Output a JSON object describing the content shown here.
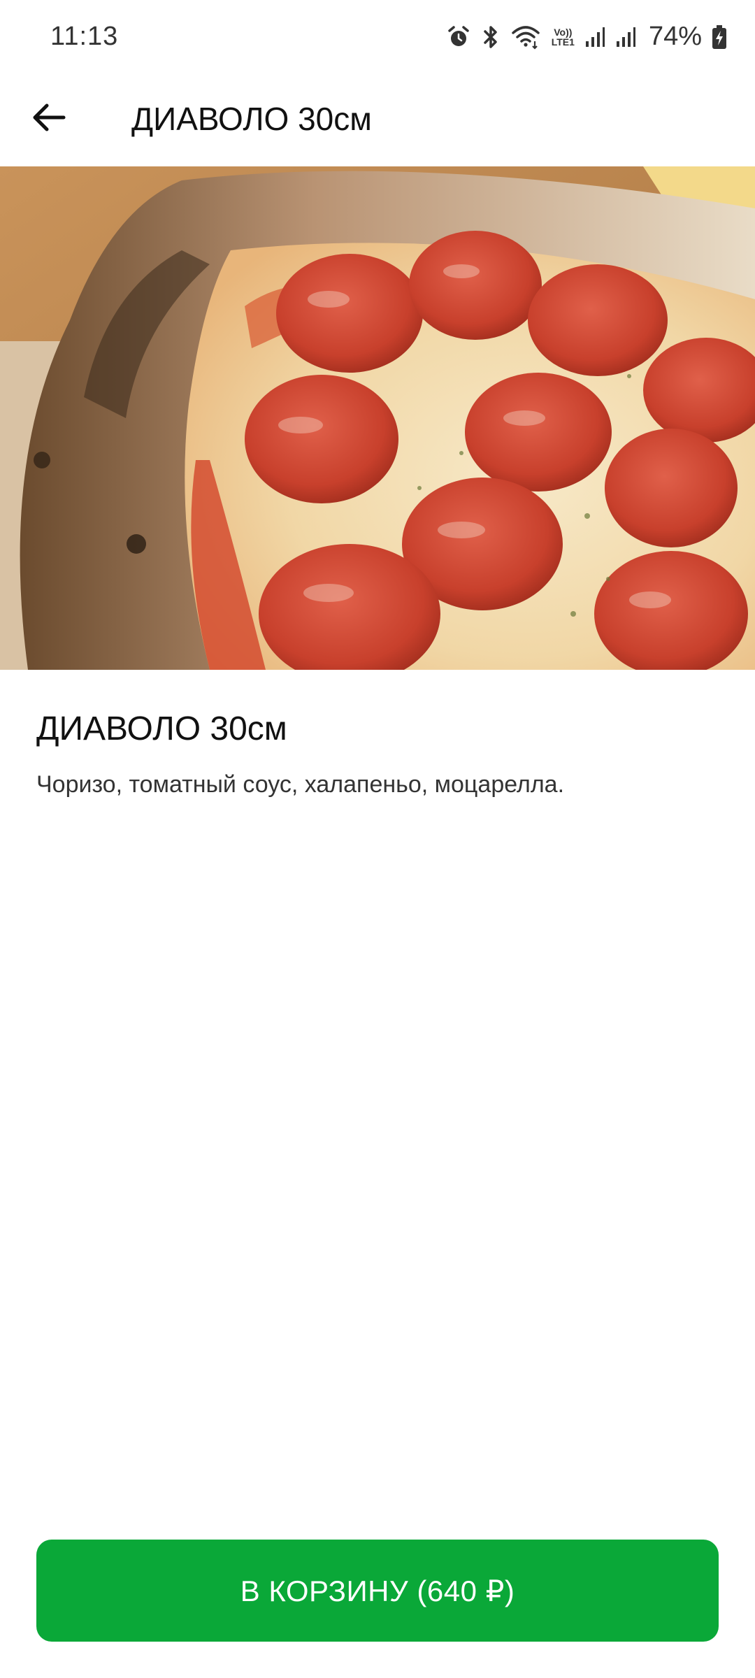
{
  "status_bar": {
    "time": "11:13",
    "battery_percent": "74%",
    "icons": [
      "alarm-icon",
      "bluetooth-icon",
      "wifi-icon",
      "volte-lte-icon",
      "signal-icon",
      "signal-icon",
      "battery-charging-icon"
    ],
    "volte_label_top": "Vo))",
    "volte_label_bottom": "LTE1"
  },
  "app_bar": {
    "back_icon": "arrow-left-icon",
    "title": "ДИАВОЛО 30см"
  },
  "product": {
    "image_alt": "pizza photo",
    "name": "ДИАВОЛО 30см",
    "description": "Чоризо, томатный соус, халапеньо, моцарелла."
  },
  "cart_button": {
    "label": "В КОРЗИНУ (640 ₽)",
    "color": "#0aa838"
  }
}
